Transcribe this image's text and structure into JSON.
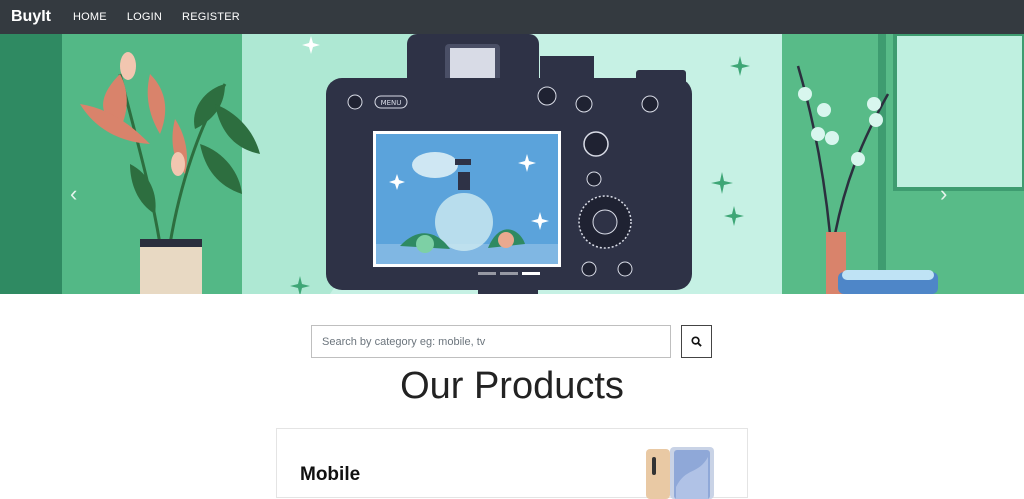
{
  "navbar": {
    "brand": "BuyIt",
    "links": [
      "HOME",
      "LOGIN",
      "REGISTER"
    ]
  },
  "carousel": {
    "prev_icon": "chevron-left-icon",
    "next_icon": "chevron-right-icon",
    "camera_label": "MENU",
    "slide_count": 3,
    "active_slide": 3
  },
  "search": {
    "placeholder": "Search by category eg: mobile, tv",
    "value": "",
    "button_icon": "search-icon"
  },
  "heading": "Our Products",
  "products": [
    {
      "title": "Mobile"
    }
  ],
  "colors": {
    "navbar_bg": "#343a40",
    "hero_mint": "#bfeee0",
    "hero_green": "#5bbf8c",
    "camera_body": "#2e3246"
  }
}
